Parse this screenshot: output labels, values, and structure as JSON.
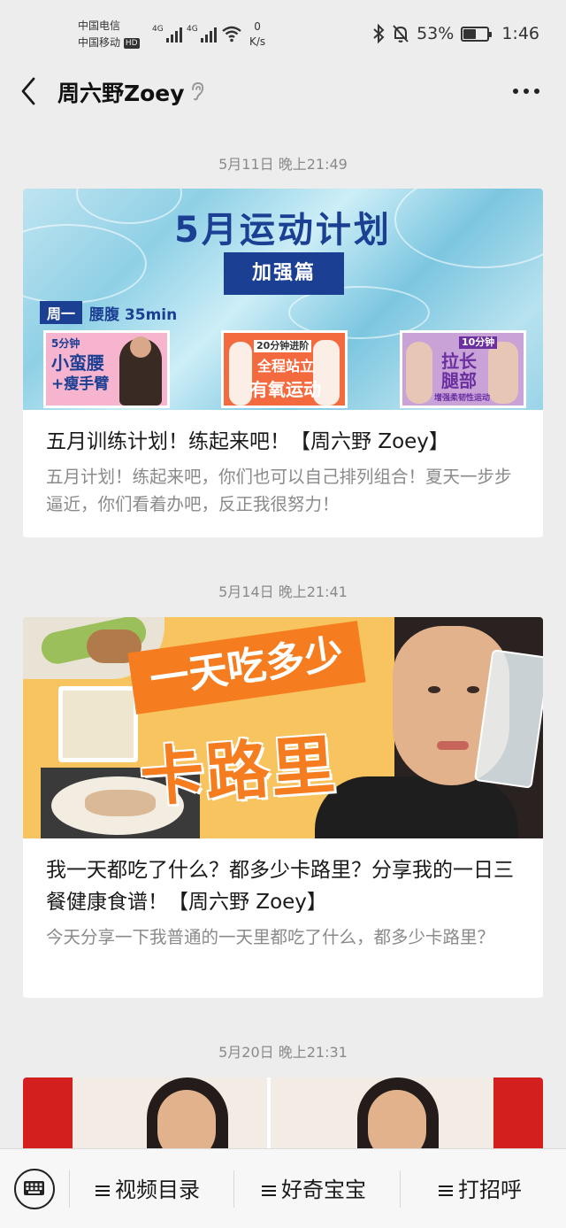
{
  "status_bar": {
    "carrier_1": "中国电信",
    "carrier_2": "中国移动",
    "hd_badge": "HD",
    "network_1": "4G",
    "network_2": "4G",
    "speed_value": "0",
    "speed_unit": "K/s",
    "battery_percent": "53%",
    "battery_level": 0.53,
    "time": "1:46"
  },
  "nav": {
    "title": "周六野Zoey",
    "icons": [
      "back-arrow-icon",
      "ear-icon",
      "more-dots-icon"
    ]
  },
  "feed": [
    {
      "timestamp": "5月11日 晚上21:49",
      "title": "五月训练计划！练起来吧！【周六野 Zoey】",
      "description": "五月计划！练起来吧，你们也可以自己排列组合！夏天一步步逼近，你们看着办吧，反正我很努力！",
      "cover": {
        "headline": "5月运动计划",
        "banner": "加强篇",
        "day_tag": "周一",
        "day_text": "腰腹 35min",
        "thumbs": [
          {
            "line1": "5分钟",
            "line2": "小蛮腰",
            "line3": "+瘦手臂"
          },
          {
            "line1": "20分钟进阶",
            "line2": "全程站立",
            "line3": "有氧运动"
          },
          {
            "line1": "10分钟",
            "line2": "拉长",
            "line3": "腿部",
            "line4": "增强柔韧性运动"
          }
        ]
      }
    },
    {
      "timestamp": "5月14日 晚上21:41",
      "title": "我一天都吃了什么？都多少卡路里？分享我的一日三餐健康食谱！【周六野 Zoey】",
      "description": "今天分享一下我普通的一天里都吃了什么，都多少卡路里？",
      "cover": {
        "headline_top": "一天吃多少",
        "headline_big": "卡路里"
      }
    },
    {
      "timestamp": "5月20日 晚上21:31"
    }
  ],
  "bottom_menu": {
    "keyboard_icon": "keyboard-icon",
    "items": [
      {
        "label": "视频目录"
      },
      {
        "label": "好奇宝宝"
      },
      {
        "label": "打招呼"
      }
    ]
  },
  "colors": {
    "background": "#ededed",
    "card": "#ffffff",
    "text_primary": "#1a1a1a",
    "text_secondary": "#8a8a8a",
    "cover1_accent": "#1b3f93",
    "cover2_accent": "#f57c1f"
  }
}
